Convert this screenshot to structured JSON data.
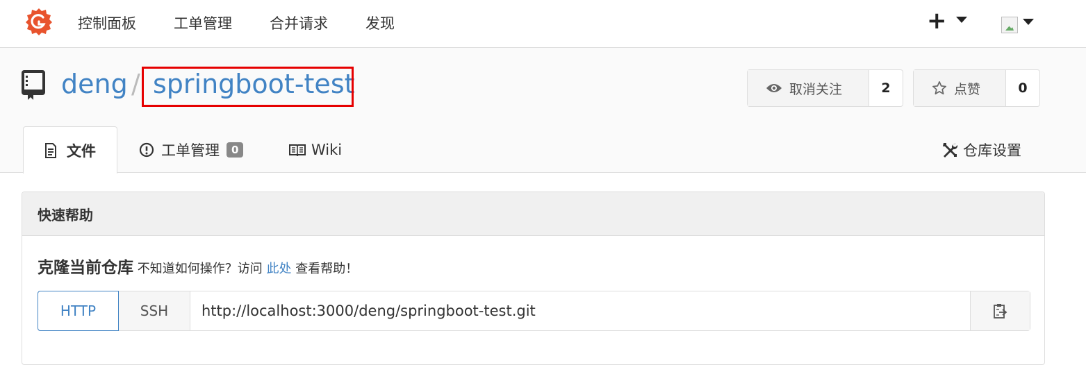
{
  "nav": {
    "items": [
      "控制面板",
      "工单管理",
      "合并请求",
      "发现"
    ],
    "plus": "+"
  },
  "repo": {
    "owner": "deng",
    "separator": "/",
    "name": "springboot-test"
  },
  "actions": {
    "watch_label": "取消关注",
    "watch_count": "2",
    "star_label": "点赞",
    "star_count": "0"
  },
  "tabs": {
    "files": "文件",
    "issues": "工单管理",
    "issues_count": "0",
    "wiki": "Wiki",
    "settings": "仓库设置"
  },
  "quick_help": {
    "title": "快速帮助",
    "clone_title": "克隆当前仓库",
    "clone_text_before": "不知道如何操作？访问",
    "link": "此处",
    "clone_text_after": "查看帮助！",
    "http_label": "HTTP",
    "ssh_label": "SSH",
    "url": "http://localhost:3000/deng/springboot-test.git"
  },
  "colors": {
    "link": "#4183c4",
    "logo": "#e8532d",
    "highlight": "#e60000"
  }
}
